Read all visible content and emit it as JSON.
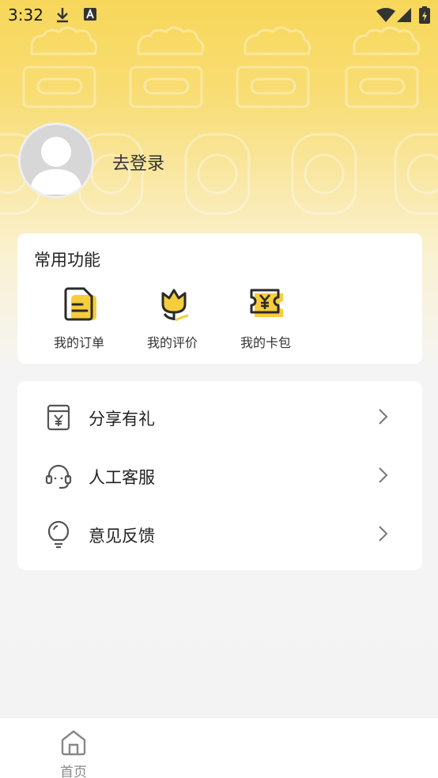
{
  "status_bar": {
    "time": "3:32",
    "icons": [
      "download-icon",
      "a-badge-icon",
      "wifi-icon",
      "signal-icon",
      "battery-icon"
    ]
  },
  "profile": {
    "login_label": "去登录",
    "avatar_icon": "user-avatar-icon"
  },
  "common_functions": {
    "title": "常用功能",
    "items": [
      {
        "label": "我的订单",
        "icon": "order-document-icon"
      },
      {
        "label": "我的评价",
        "icon": "flower-review-icon"
      },
      {
        "label": "我的卡包",
        "icon": "yuan-ticket-icon"
      }
    ]
  },
  "menu": {
    "items": [
      {
        "label": "分享有礼",
        "icon": "share-gift-icon"
      },
      {
        "label": "人工客服",
        "icon": "headset-icon"
      },
      {
        "label": "意见反馈",
        "icon": "lightbulb-icon"
      }
    ]
  },
  "bottom_nav": {
    "items": [
      {
        "label": "首页",
        "icon": "home-icon"
      }
    ]
  },
  "colors": {
    "accent_yellow": "#f7d75a",
    "icon_yellow": "#f6cd3c",
    "card_bg": "#ffffff",
    "page_bg": "#f3f3f3"
  }
}
